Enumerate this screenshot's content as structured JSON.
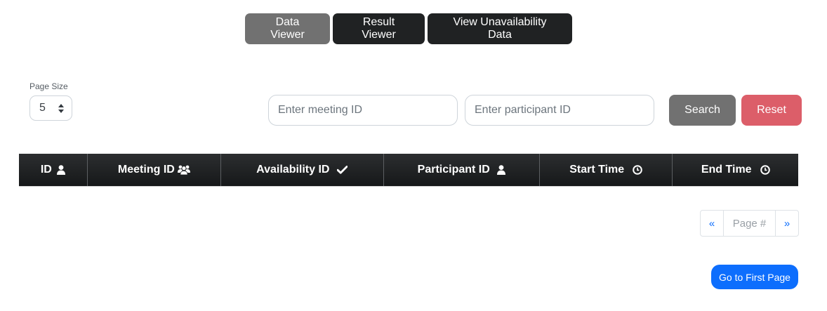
{
  "nav": {
    "tabs": [
      {
        "label": "Data Viewer",
        "active": true
      },
      {
        "label": "Result Viewer",
        "active": false
      },
      {
        "label": "View Unavailability Data",
        "active": false
      }
    ]
  },
  "filters": {
    "page_size_label": "Page Size",
    "page_size_value": "5",
    "meeting_placeholder": "Enter meeting ID",
    "participant_placeholder": "Enter participant ID",
    "search_label": "Search",
    "reset_label": "Reset"
  },
  "table": {
    "columns": [
      {
        "label": "ID",
        "icon": "user-icon"
      },
      {
        "label": "Meeting ID",
        "icon": "users-icon"
      },
      {
        "label": "Availability ID",
        "icon": "check-icon"
      },
      {
        "label": "Participant ID",
        "icon": "user-icon"
      },
      {
        "label": "Start Time",
        "icon": "clock-icon"
      },
      {
        "label": "End Time",
        "icon": "clock-icon"
      }
    ],
    "rows": []
  },
  "pagination": {
    "prev": "«",
    "page_placeholder": "Page #",
    "next": "»",
    "first_page_label": "Go to First Page"
  },
  "colors": {
    "active_tab": "#717171",
    "dark_tab": "#202223",
    "reset": "#dc5e69",
    "primary": "#0d6efd"
  }
}
